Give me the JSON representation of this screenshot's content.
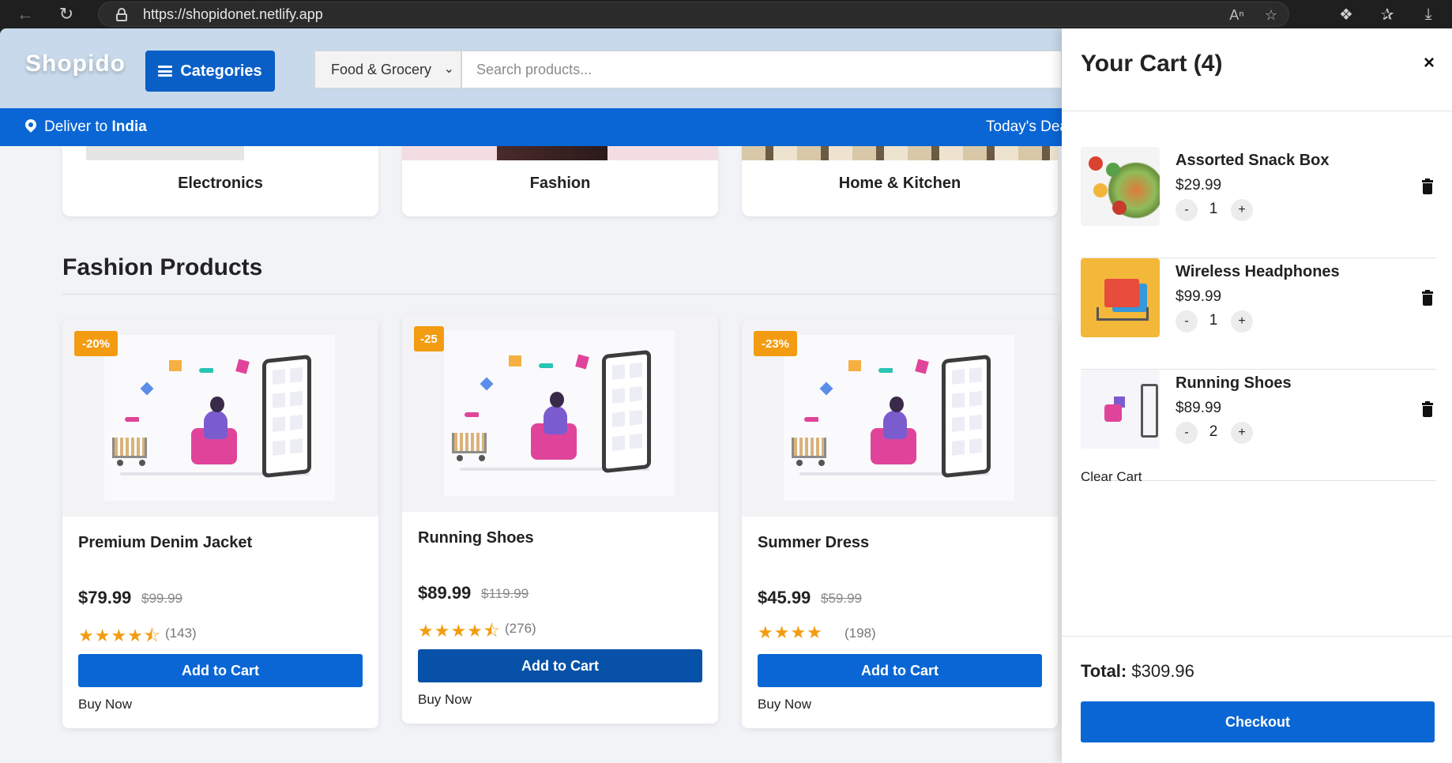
{
  "browser": {
    "url": "https://shopidonet.netlify.app"
  },
  "header": {
    "logo": "Shopido",
    "categories_label": "Categories",
    "category_select_value": "Food & Grocery",
    "search_placeholder": "Search products..."
  },
  "deliver_bar": {
    "prefix": "Deliver to ",
    "country": "India",
    "deals": "Today's Deal"
  },
  "categories": [
    {
      "label": "Electronics"
    },
    {
      "label": "Fashion"
    },
    {
      "label": "Home & Kitchen"
    }
  ],
  "section": {
    "title": "Fashion Products"
  },
  "products": [
    {
      "badge": "-20%",
      "name": "Premium Denim Jacket",
      "price": "$79.99",
      "old_price": "$99.99",
      "stars": "★★★★⯪",
      "rating": 4.5,
      "reviews": "(143)",
      "add_label": "Add to Cart",
      "buy_label": "Buy Now"
    },
    {
      "badge": "-25",
      "name": "Running Shoes",
      "price": "$89.99",
      "old_price": "$119.99",
      "stars": "★★★★⯪",
      "rating": 4.5,
      "reviews": "(276)",
      "add_label": "Add to Cart",
      "buy_label": "Buy Now"
    },
    {
      "badge": "-23%",
      "name": "Summer Dress",
      "price": "$45.99",
      "old_price": "$59.99",
      "stars": "★★★★",
      "rating": 4,
      "reviews": "(198)",
      "add_label": "Add to Cart",
      "buy_label": "Buy Now"
    }
  ],
  "cart": {
    "title": "Your Cart (4)",
    "close": "×",
    "items": [
      {
        "name": "Assorted Snack Box",
        "price": "$29.99",
        "qty": "1",
        "minus": "-",
        "plus": "+"
      },
      {
        "name": "Wireless Headphones",
        "price": "$99.99",
        "qty": "1",
        "minus": "-",
        "plus": "+"
      },
      {
        "name": "Running Shoes",
        "price": "$89.99",
        "qty": "2",
        "minus": "-",
        "plus": "+"
      }
    ],
    "clear_label": "Clear Cart",
    "total_label": "Total:",
    "total_value": "$309.96",
    "checkout_label": "Checkout"
  },
  "colors": {
    "primary": "#0a66d4",
    "badge": "#f39c12",
    "header_bg": "#c7d9ea"
  }
}
